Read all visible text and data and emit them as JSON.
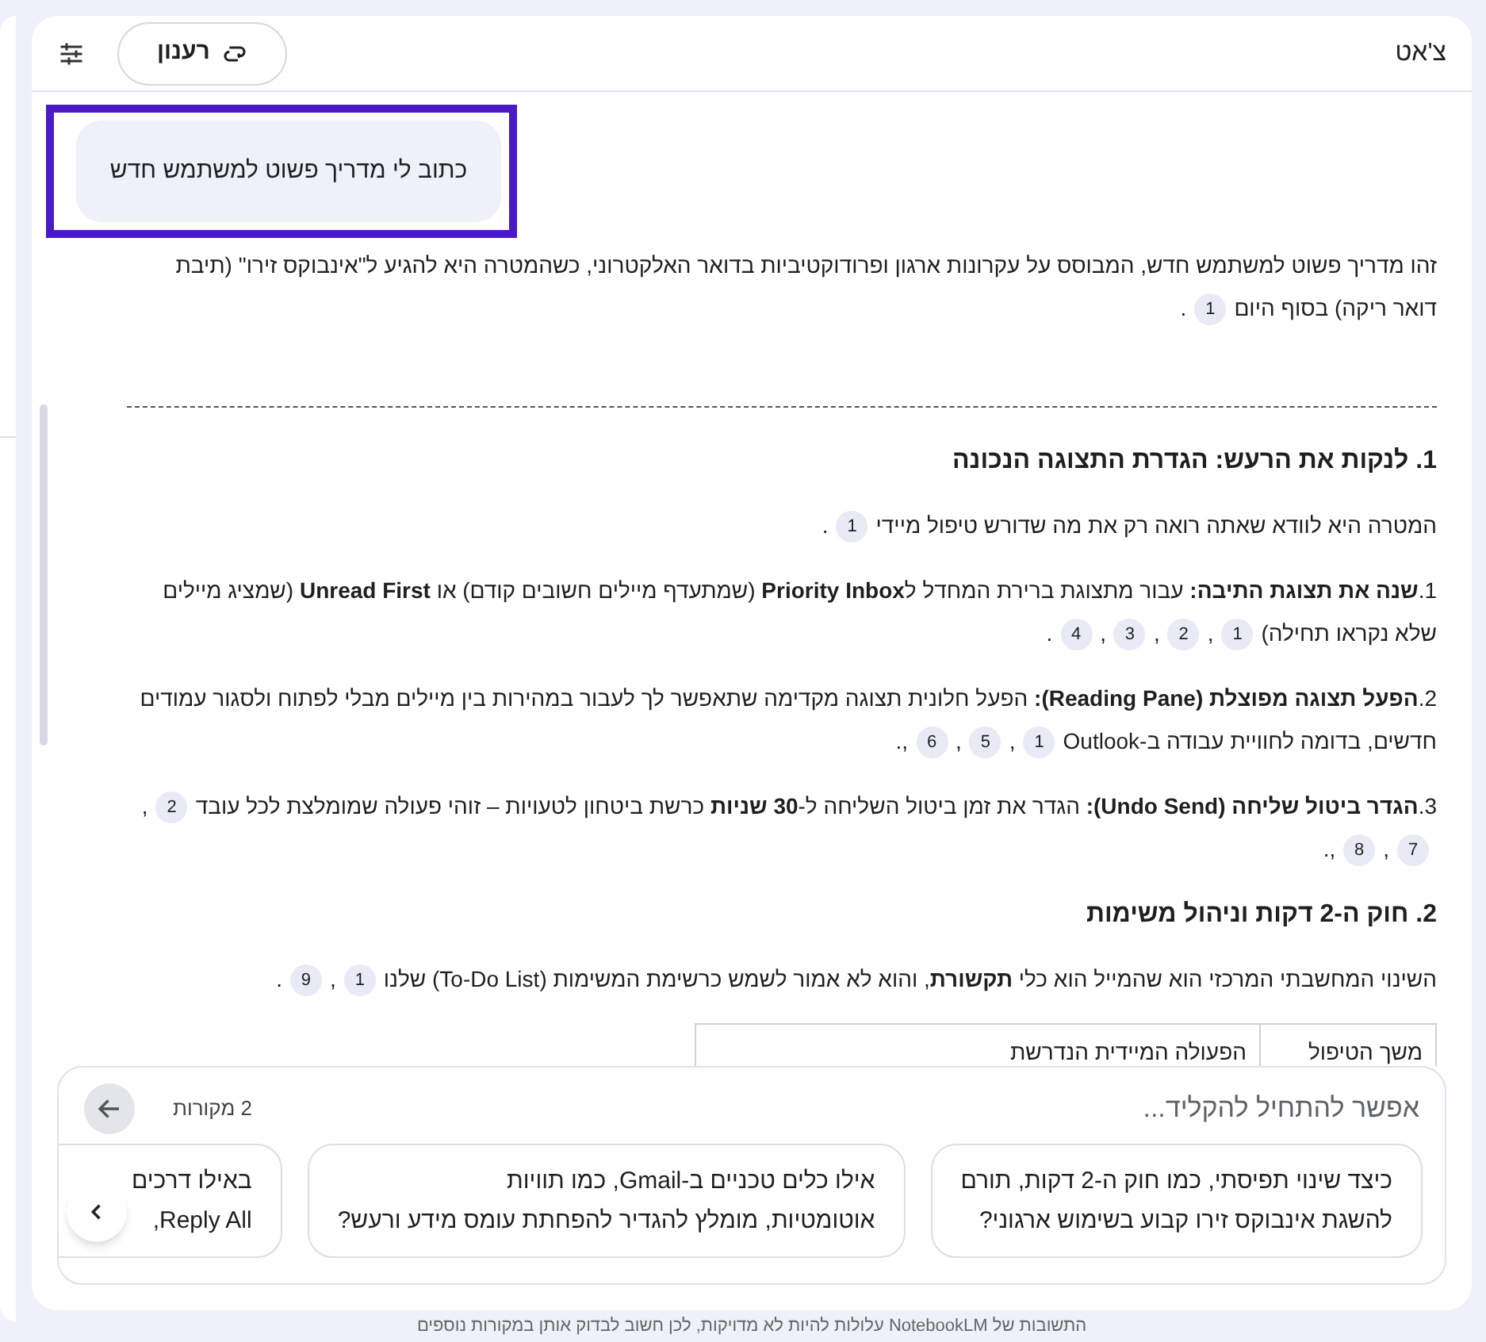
{
  "chat": {
    "title": "צ'אט",
    "refresh_button": "רענון"
  },
  "user_message": "כתוב לי מדריך פשוט למשתמש חדש",
  "response": [
    {
      "kind": "paragraph",
      "parts": [
        {
          "kind": "text",
          "text": "זהו מדריך פשוט למשתמש חדש, המבוסס על עקרונות ארגון ופרודוקטיביות בדואר האלקטרוני, כשהמטרה היא להגיע ל\"אינבוקס זירו\" (תיבת דואר ריקה) בסוף היום"
        },
        {
          "kind": "cite",
          "text": "1"
        },
        {
          "kind": "text",
          "text": "."
        }
      ]
    },
    {
      "kind": "rule"
    },
    {
      "kind": "heading",
      "text": "1. לנקות את הרעש: הגדרת התצוגה הנכונה"
    },
    {
      "kind": "paragraph",
      "parts": [
        {
          "kind": "text",
          "text": "המטרה היא לוודא שאתה רואה רק את מה שדורש טיפול מיידי"
        },
        {
          "kind": "cite",
          "text": "1"
        },
        {
          "kind": "text",
          "text": "."
        }
      ]
    },
    {
      "kind": "item",
      "number": "1.",
      "parts": [
        {
          "kind": "text",
          "text": "**שנה את תצוגת התיבה:** עבור מתצוגת ברירת המחדל ל**Priority Inbox** (שמתעדף מיילים חשובים קודם) או **Unread First** (שמציג מיילים שלא נקראו תחילה)"
        },
        {
          "kind": "cite",
          "text": "1"
        },
        {
          "kind": "text",
          "text": ","
        },
        {
          "kind": "cite",
          "text": "2"
        },
        {
          "kind": "text",
          "text": ","
        },
        {
          "kind": "cite",
          "text": "3"
        },
        {
          "kind": "text",
          "text": ","
        },
        {
          "kind": "cite",
          "text": "4"
        },
        {
          "kind": "text",
          "text": "."
        }
      ]
    },
    {
      "kind": "item",
      "number": "2.",
      "parts": [
        {
          "kind": "text",
          "text": "**הפעל תצוגה מפוצלת (Reading Pane):** הפעל חלונית תצוגה מקדימה שתאפשר לך לעבור במהירות בין מיילים מבלי לפתוח ולסגור עמודים חדשים, בדומה לחוויית עבודה ב-Outlook"
        },
        {
          "kind": "cite",
          "text": "1"
        },
        {
          "kind": "text",
          "text": ","
        },
        {
          "kind": "cite",
          "text": "5"
        },
        {
          "kind": "text",
          "text": ","
        },
        {
          "kind": "cite",
          "text": "6"
        },
        {
          "kind": "text",
          "text": ",."
        }
      ]
    },
    {
      "kind": "item",
      "number": "3.",
      "parts": [
        {
          "kind": "text",
          "text": "**הגדר ביטול שליחה (Undo Send):** הגדר את זמן ביטול השליחה ל-**30 שניות** כרשת ביטחון לטעויות – זוהי פעולה שמומלצת לכל עובד"
        },
        {
          "kind": "cite",
          "text": "2"
        },
        {
          "kind": "text",
          "text": ","
        },
        {
          "kind": "cite",
          "text": "7"
        },
        {
          "kind": "text",
          "text": ","
        },
        {
          "kind": "cite",
          "text": "8"
        },
        {
          "kind": "text",
          "text": ",."
        }
      ]
    },
    {
      "kind": "heading",
      "text": "2. חוק ה-2 דקות וניהול משימות"
    },
    {
      "kind": "paragraph",
      "parts": [
        {
          "kind": "text",
          "text": "השינוי המחשבתי המרכזי הוא שהמייל הוא כלי **תקשורת**, והוא לא אמור לשמש כרשימת המשימות (To-Do List) שלנו"
        },
        {
          "kind": "cite",
          "text": "1"
        },
        {
          "kind": "text",
          "text": ","
        },
        {
          "kind": "cite",
          "text": "9"
        },
        {
          "kind": "text",
          "text": "."
        }
      ]
    },
    {
      "kind": "table",
      "columns": [
        "משך הטיפול",
        "הפעולה המיידית הנדרשת"
      ]
    }
  ],
  "composer": {
    "placeholder": "אפשר להתחיל להקליד...",
    "sources": "2 מקורות",
    "suggestions": [
      {
        "lines": [
          "כיצד שינוי תפיסתי, כמו חוק ה-2 דקות, תורם",
          "להשגת אינבוקס זירו קבוע בשימוש ארגוני?"
        ]
      },
      {
        "lines": [
          "אילו כלים טכניים ב-Gmail, כמו תוויות",
          "אוטומטיות, מומלץ להגדיר להפחתת עומס מידע ורעש?"
        ]
      },
      {
        "lines": [
          "באילו דרכים",
          "Reply All,"
        ]
      }
    ]
  },
  "disclaimer": "התשובות של NotebookLM עלולות להיות לא מדויקות, לכן חשוב לבדוק אותן במקורות נוספים"
}
